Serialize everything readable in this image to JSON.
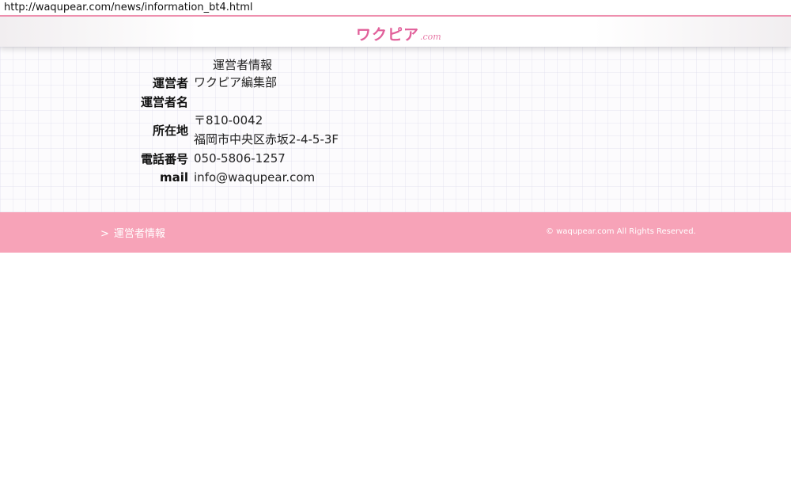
{
  "browser": {
    "url": "http://waqupear.com/news/information_bt4.html"
  },
  "header": {
    "logo_main": "ワクピア",
    "logo_sub": ".com"
  },
  "info": {
    "caption": "運営者情報",
    "rows": [
      {
        "label": "運営者",
        "value": "ワクピア編集部"
      },
      {
        "label": "運営者名",
        "value": ""
      },
      {
        "label": "所在地",
        "value_line1": "〒810-0042",
        "value_line2": "福岡市中央区赤坂2-4-5-3F"
      },
      {
        "label": "電話番号",
        "value": "050-5806-1257"
      },
      {
        "label": "mail",
        "value": "info@waqupear.com"
      }
    ]
  },
  "footer": {
    "chevron": ">",
    "link_label": "運営者情報",
    "copyright": "© waqupear.com All Rights Reserved."
  }
}
